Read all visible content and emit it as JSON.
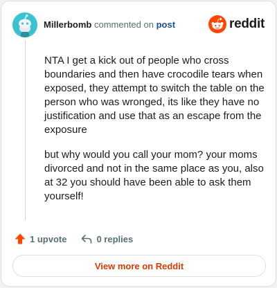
{
  "comment": {
    "author": "Millerbomb",
    "action_text": "commented on",
    "post_link": "post",
    "paragraphs": [
      "NTA I get a kick out of people who cross boundaries and then have crocodile tears when exposed, they attempt to switch the table on the person who was wronged, its like they have no justification and use that as an escape from the exposure",
      "but why would you call your mom? your moms divorced and not in the same place as you, also at 32 you should have been able to ask them yourself!"
    ]
  },
  "brand": {
    "name": "reddit",
    "accent": "#ff4500"
  },
  "actions": {
    "upvotes": "1 upvote",
    "replies": "0 replies"
  },
  "footer": {
    "view_more": "View more on Reddit"
  },
  "icons": [
    "snoo-avatar-icon",
    "reddit-logo-icon",
    "upvote-arrow-icon",
    "reply-arrow-icon"
  ]
}
